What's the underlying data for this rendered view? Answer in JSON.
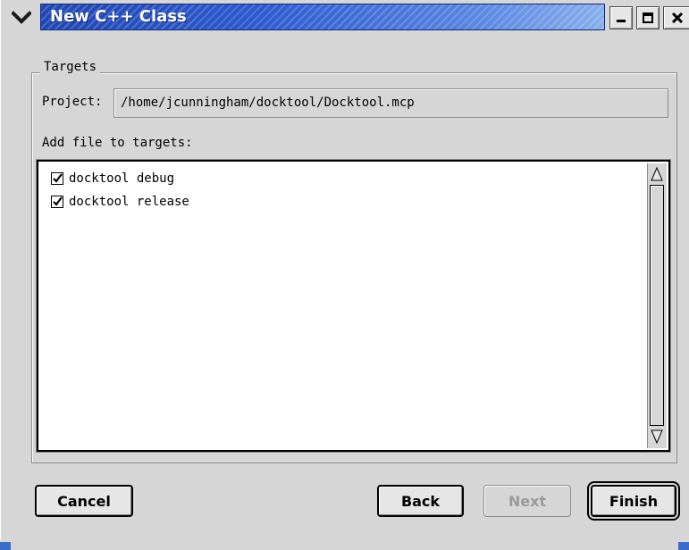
{
  "window": {
    "title": "New C++ Class"
  },
  "targets_group": {
    "legend": "Targets",
    "project_label": "Project:",
    "project_value": "/home/jcunningham/docktool/Docktool.mcp",
    "add_file_label": "Add file to targets:",
    "targets": [
      {
        "label": "docktool debug",
        "checked": true
      },
      {
        "label": "docktool release",
        "checked": true
      }
    ]
  },
  "buttons": {
    "cancel": "Cancel",
    "back": "Back",
    "next": "Next",
    "finish": "Finish"
  },
  "colors": {
    "titlebar": "#2e5bd0",
    "window_bg": "#d6d6d6"
  }
}
